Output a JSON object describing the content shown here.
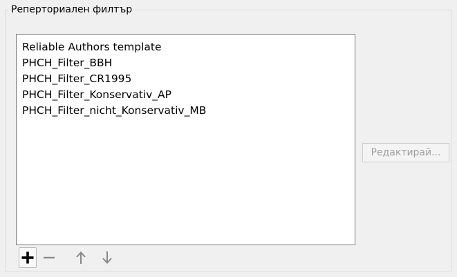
{
  "group": {
    "title": "Реперториален филтър"
  },
  "list": {
    "items": [
      {
        "label": "Reliable Authors template"
      },
      {
        "label": "PHCH_Filter_BBH"
      },
      {
        "label": "PHCH_Filter_CR1995"
      },
      {
        "label": "PHCH_Filter_Konservativ_AP"
      },
      {
        "label": "PHCH_Filter_nicht_Konservativ_MB"
      }
    ]
  },
  "buttons": {
    "edit_label": "Редактирай...",
    "edit_enabled": false
  },
  "toolbar": {
    "add_icon": "plus-icon",
    "remove_icon": "minus-icon",
    "move_up_icon": "arrow-up-icon",
    "move_down_icon": "arrow-down-icon",
    "remove_enabled": false,
    "move_up_enabled": false,
    "move_down_enabled": false
  },
  "colors": {
    "background": "#f0f0f0",
    "list_background": "#ffffff",
    "disabled_text": "#a0a0a0",
    "disabled_icon": "#8a8a8a"
  }
}
